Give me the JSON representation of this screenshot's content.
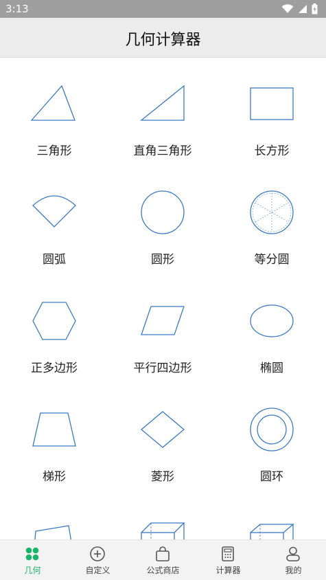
{
  "status_bar": {
    "time": "3:13"
  },
  "header": {
    "title": "几何计算器"
  },
  "shapes": [
    {
      "label": "三角形",
      "icon": "triangle-icon"
    },
    {
      "label": "直角三角形",
      "icon": "right-triangle-icon"
    },
    {
      "label": "长方形",
      "icon": "rectangle-icon"
    },
    {
      "label": "圆弧",
      "icon": "arc-sector-icon"
    },
    {
      "label": "圆形",
      "icon": "circle-icon"
    },
    {
      "label": "等分圆",
      "icon": "divided-circle-icon"
    },
    {
      "label": "正多边形",
      "icon": "hexagon-icon"
    },
    {
      "label": "平行四边形",
      "icon": "parallelogram-icon"
    },
    {
      "label": "椭圆",
      "icon": "ellipse-icon"
    },
    {
      "label": "梯形",
      "icon": "trapezoid-icon"
    },
    {
      "label": "菱形",
      "icon": "rhombus-icon"
    },
    {
      "label": "圆环",
      "icon": "ring-icon"
    }
  ],
  "bottom_nav": [
    {
      "label": "几何",
      "icon": "geometry-grid-icon",
      "active": true
    },
    {
      "label": "自定义",
      "icon": "add-circle-icon",
      "active": false
    },
    {
      "label": "公式商店",
      "icon": "shopping-bag-icon",
      "active": false
    },
    {
      "label": "计算器",
      "icon": "calculator-icon",
      "active": false
    },
    {
      "label": "我的",
      "icon": "user-icon",
      "active": false
    }
  ],
  "colors": {
    "shape_stroke": "#3a78c2",
    "active_tab": "#19b36b",
    "header_bg": "#ececec",
    "status_bg": "#9e9e9e"
  }
}
